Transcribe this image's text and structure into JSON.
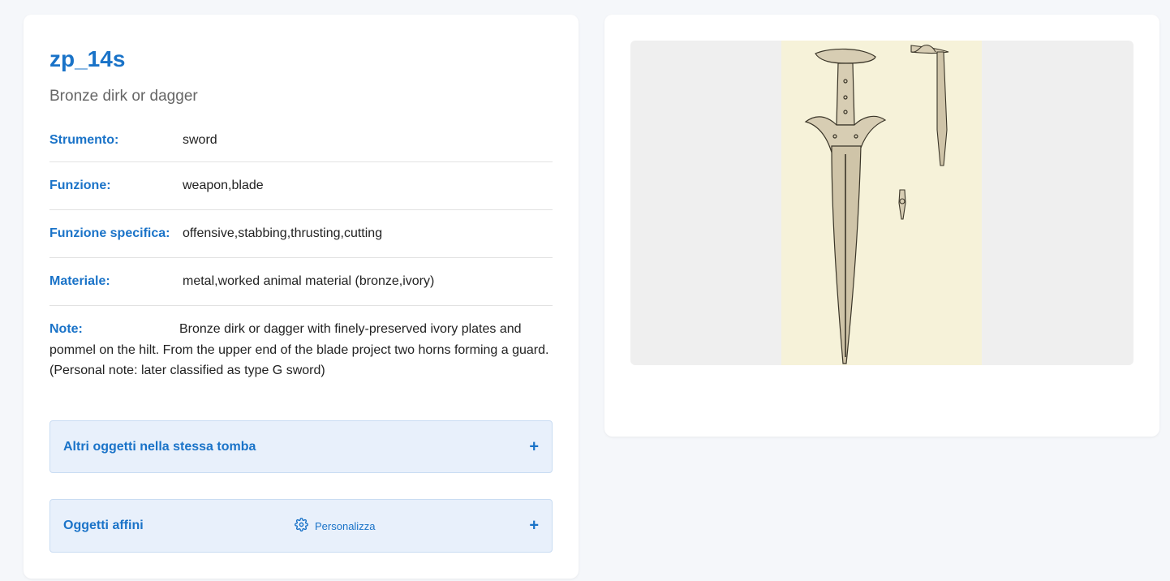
{
  "item": {
    "title": "zp_14s",
    "subtitle": "Bronze dirk or dagger"
  },
  "fields": [
    {
      "label": "Strumento:",
      "value": "sword"
    },
    {
      "label": "Funzione:",
      "value": "weapon,blade"
    },
    {
      "label": "Funzione specifica:",
      "value": "offensive,stabbing,thrusting,cutting"
    },
    {
      "label": "Materiale:",
      "value": "metal,worked animal material (bronze,ivory)"
    }
  ],
  "note": {
    "label": "Note:",
    "text": "Bronze dirk or dagger with finely-preserved ivory plates and pommel on the hilt. From the upper end of the blade project two horns forming a guard. (Personal note: later classified as type G sword)"
  },
  "accordions": {
    "same_tomb": {
      "title": "Altri oggetti nella stessa tomba",
      "toggle": "+"
    },
    "related": {
      "title": "Oggetti affini",
      "customize_label": "Personalizza",
      "toggle": "+"
    }
  },
  "image": {
    "description_icon": "dagger-illustration",
    "colors": {
      "plate": "#f6f2d9",
      "frame": "#efefef",
      "accent": "#1a73c8"
    }
  }
}
